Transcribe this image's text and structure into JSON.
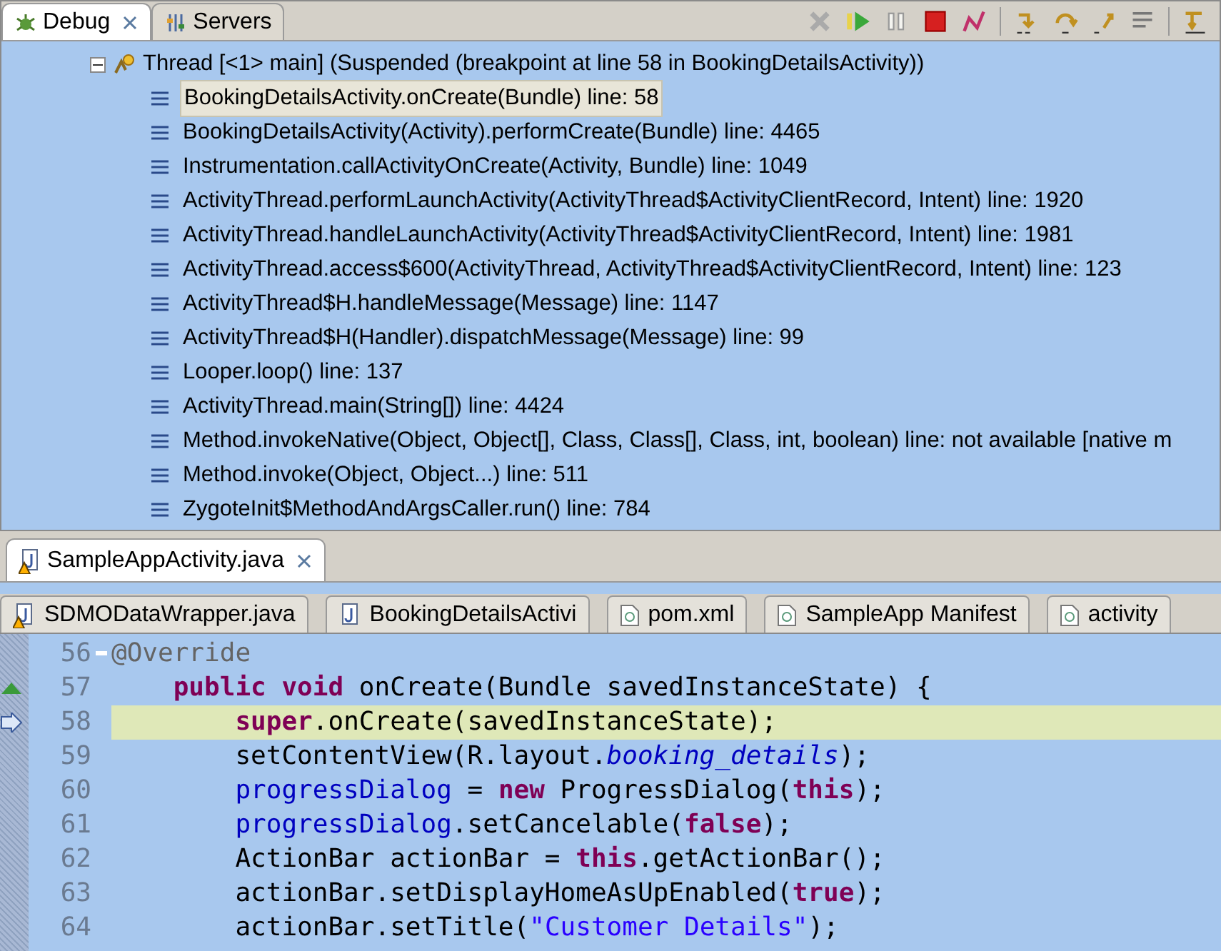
{
  "debug_view": {
    "tabs": [
      {
        "label": "Debug",
        "selected": true
      },
      {
        "label": "Servers",
        "selected": false
      }
    ],
    "thread": {
      "label": "Thread [<1> main] (Suspended (breakpoint at line 58 in BookingDetailsActivity))",
      "expanded": true,
      "frames": [
        {
          "label": "BookingDetailsActivity.onCreate(Bundle) line: 58",
          "selected": true
        },
        {
          "label": "BookingDetailsActivity(Activity).performCreate(Bundle) line: 4465",
          "selected": false
        },
        {
          "label": "Instrumentation.callActivityOnCreate(Activity, Bundle) line: 1049",
          "selected": false
        },
        {
          "label": "ActivityThread.performLaunchActivity(ActivityThread$ActivityClientRecord, Intent) line: 1920",
          "selected": false
        },
        {
          "label": "ActivityThread.handleLaunchActivity(ActivityThread$ActivityClientRecord, Intent) line: 1981",
          "selected": false
        },
        {
          "label": "ActivityThread.access$600(ActivityThread, ActivityThread$ActivityClientRecord, Intent) line: 123",
          "selected": false
        },
        {
          "label": "ActivityThread$H.handleMessage(Message) line: 1147",
          "selected": false
        },
        {
          "label": "ActivityThread$H(Handler).dispatchMessage(Message) line: 99",
          "selected": false
        },
        {
          "label": "Looper.loop() line: 137",
          "selected": false
        },
        {
          "label": "ActivityThread.main(String[]) line: 4424",
          "selected": false
        },
        {
          "label": "Method.invokeNative(Object, Object[], Class, Class[], Class, int, boolean) line: not available [native m",
          "selected": false
        },
        {
          "label": "Method.invoke(Object, Object...) line: 511",
          "selected": false
        },
        {
          "label": "ZygoteInit$MethodAndArgsCaller.run() line: 784",
          "selected": false
        }
      ]
    }
  },
  "editor": {
    "active_tab": {
      "label": "SampleAppActivity.java",
      "warning": true
    },
    "tabs": [
      {
        "label": "SDMODataWrapper.java",
        "kind": "java",
        "warning": true
      },
      {
        "label": "BookingDetailsActivi",
        "kind": "java",
        "warning": false
      },
      {
        "label": "pom.xml",
        "kind": "xml",
        "warning": false
      },
      {
        "label": "SampleApp Manifest",
        "kind": "xml",
        "warning": false
      },
      {
        "label": "activity",
        "kind": "xml",
        "warning": false
      }
    ],
    "lines": [
      {
        "number": "56",
        "foldable": true,
        "overrides": false,
        "current": false,
        "tokens": [
          {
            "kind": "annotation",
            "text": "@Override"
          }
        ]
      },
      {
        "number": "57",
        "foldable": false,
        "overrides": true,
        "current": false,
        "tokens": [
          {
            "kind": "keyword",
            "text": "    public void"
          },
          {
            "kind": "plain",
            "text": " onCreate(Bundle savedInstanceState) {"
          }
        ]
      },
      {
        "number": "58",
        "foldable": false,
        "overrides": false,
        "current": true,
        "tokens": [
          {
            "kind": "keyword",
            "text": "        super"
          },
          {
            "kind": "plain",
            "text": ".onCreate(savedInstanceState);"
          }
        ]
      },
      {
        "number": "59",
        "foldable": false,
        "overrides": false,
        "current": false,
        "tokens": [
          {
            "kind": "plain",
            "text": "        setContentView(R.layout."
          },
          {
            "kind": "static",
            "text": "booking_details"
          },
          {
            "kind": "plain",
            "text": ");"
          }
        ]
      },
      {
        "number": "60",
        "foldable": false,
        "overrides": false,
        "current": false,
        "tokens": [
          {
            "kind": "field",
            "text": "        progressDialog"
          },
          {
            "kind": "plain",
            "text": " = "
          },
          {
            "kind": "keyword",
            "text": "new"
          },
          {
            "kind": "plain",
            "text": " ProgressDialog("
          },
          {
            "kind": "keyword",
            "text": "this"
          },
          {
            "kind": "plain",
            "text": ");"
          }
        ]
      },
      {
        "number": "61",
        "foldable": false,
        "overrides": false,
        "current": false,
        "tokens": [
          {
            "kind": "field",
            "text": "        progressDialog"
          },
          {
            "kind": "plain",
            "text": ".setCancelable("
          },
          {
            "kind": "keyword",
            "text": "false"
          },
          {
            "kind": "plain",
            "text": ");"
          }
        ]
      },
      {
        "number": "62",
        "foldable": false,
        "overrides": false,
        "current": false,
        "tokens": [
          {
            "kind": "plain",
            "text": "        ActionBar actionBar = "
          },
          {
            "kind": "keyword",
            "text": "this"
          },
          {
            "kind": "plain",
            "text": ".getActionBar();"
          }
        ]
      },
      {
        "number": "63",
        "foldable": false,
        "overrides": false,
        "current": false,
        "tokens": [
          {
            "kind": "plain",
            "text": "        actionBar.setDisplayHomeAsUpEnabled("
          },
          {
            "kind": "keyword",
            "text": "true"
          },
          {
            "kind": "plain",
            "text": ");"
          }
        ]
      },
      {
        "number": "64",
        "foldable": false,
        "overrides": false,
        "current": false,
        "tokens": [
          {
            "kind": "plain",
            "text": "        actionBar.setTitle("
          },
          {
            "kind": "string",
            "text": "\"Customer Details\""
          },
          {
            "kind": "plain",
            "text": ");"
          }
        ]
      }
    ]
  }
}
